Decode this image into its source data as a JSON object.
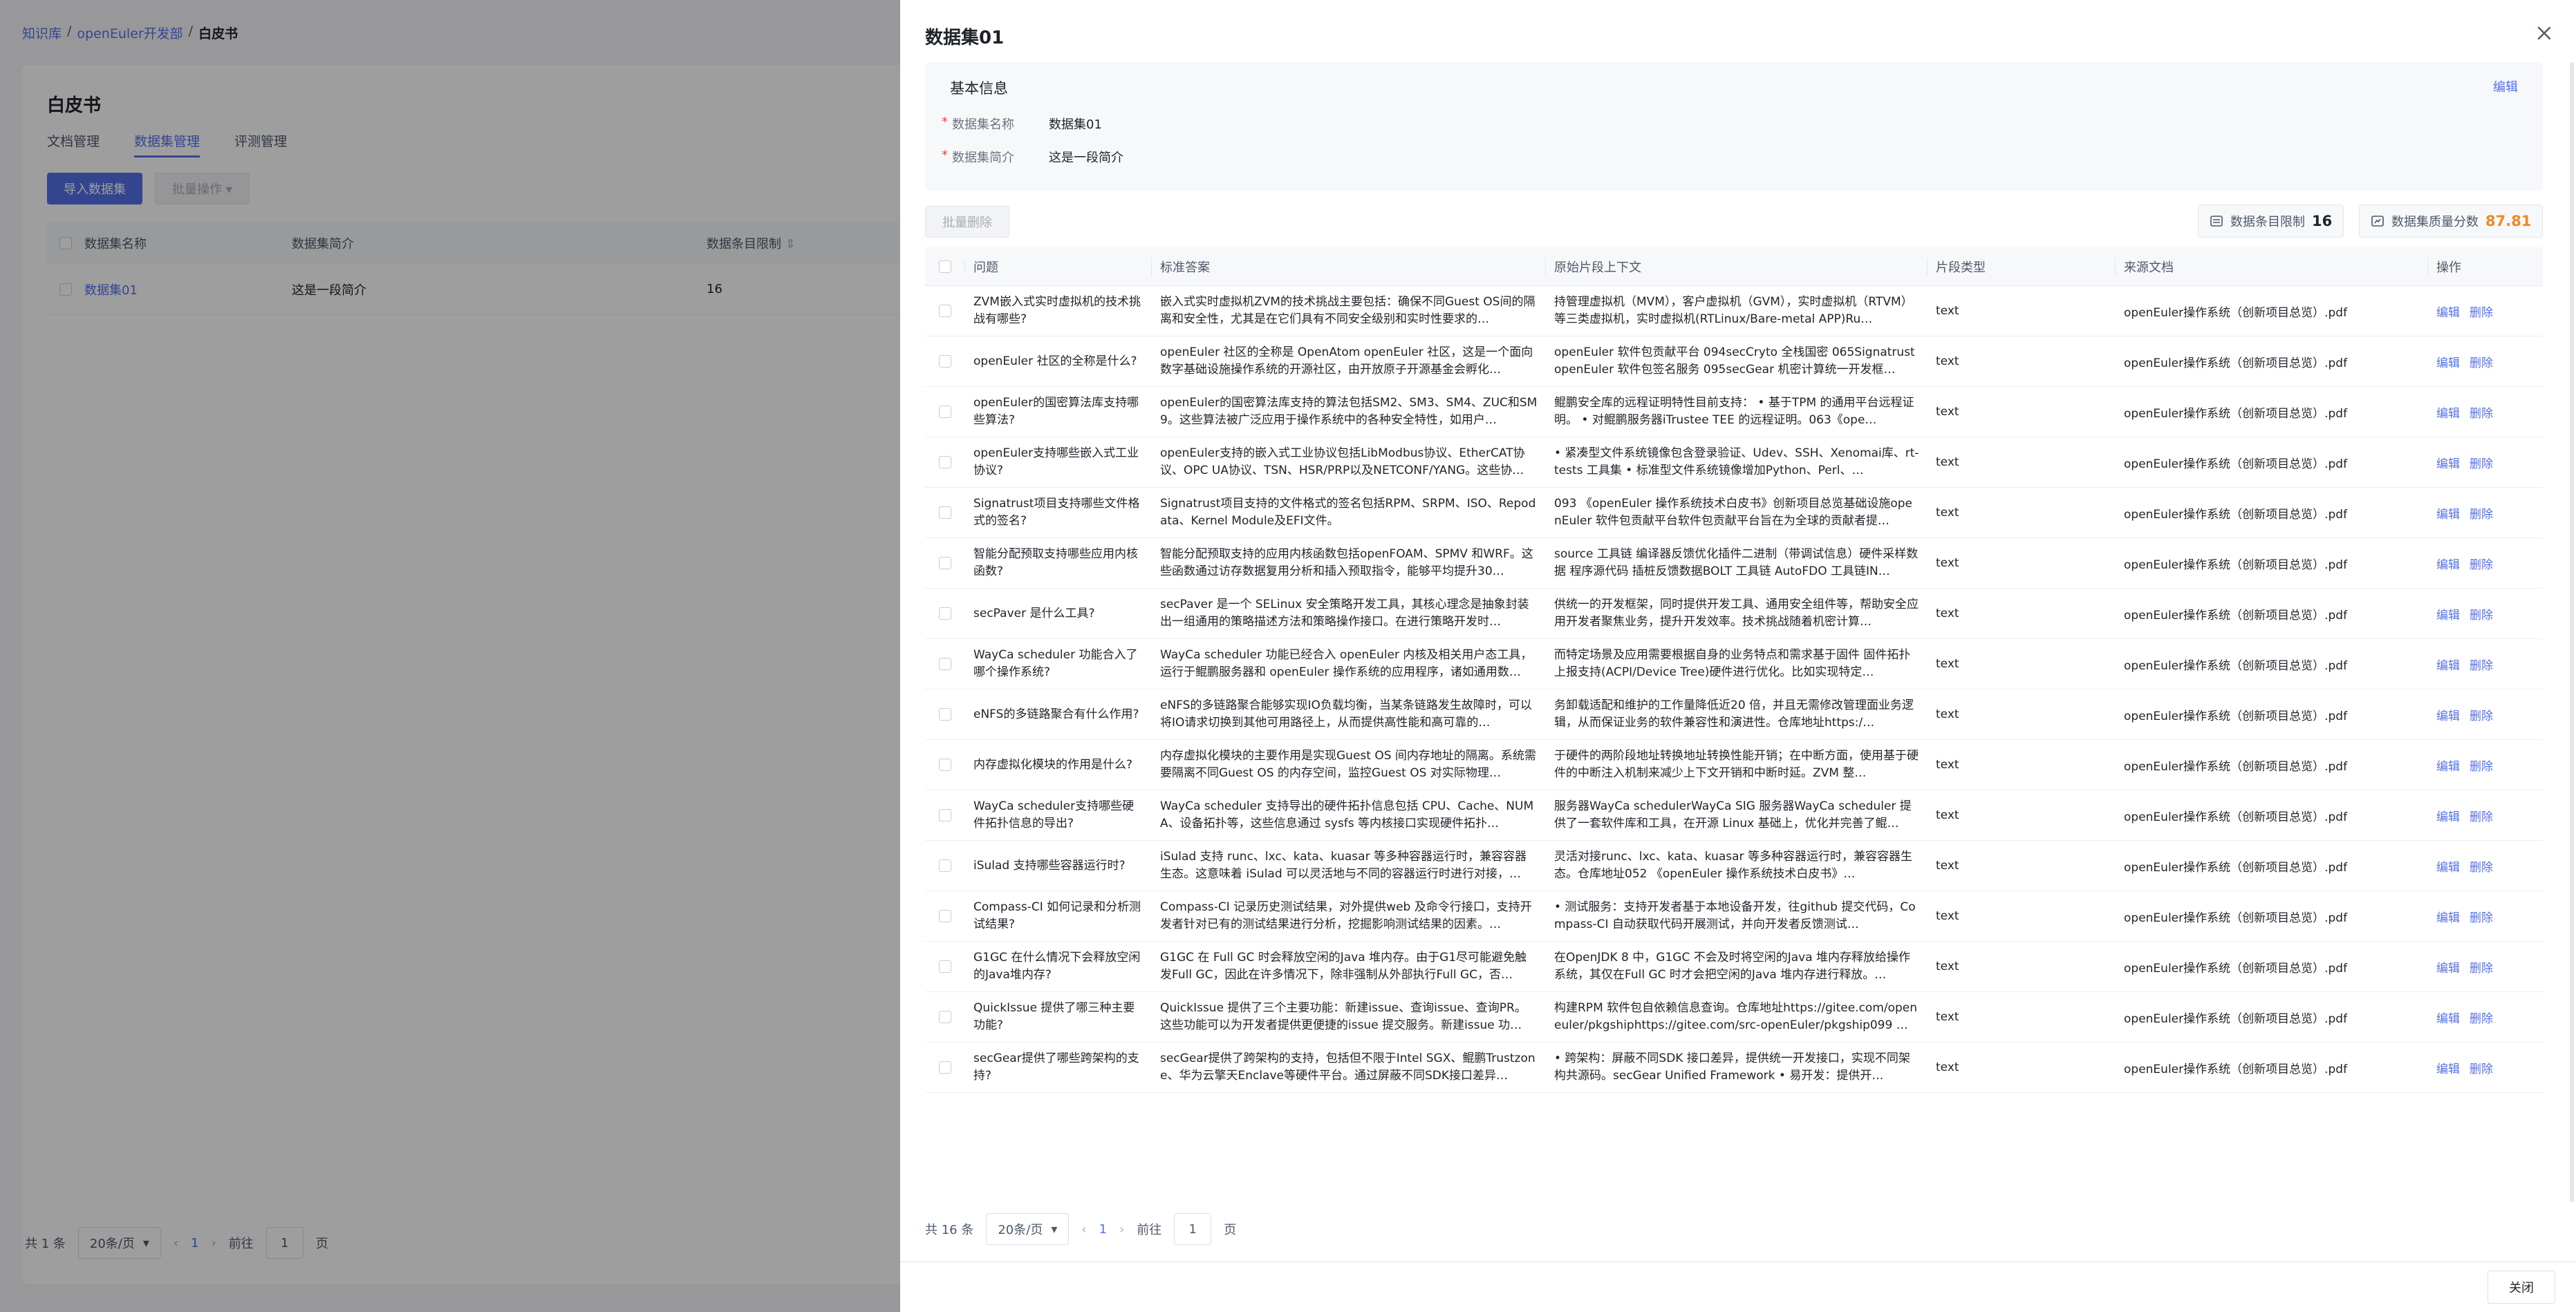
{
  "breadcrumb": [
    "知识库",
    "openEuler开发部",
    "白皮书"
  ],
  "bg": {
    "title": "白皮书",
    "tabs": [
      "文档管理",
      "数据集管理",
      "评测管理"
    ],
    "import_btn": "导入数据集",
    "batch_btn": "批量操作",
    "columns": [
      "数据集名称",
      "数据集简介",
      "数据条目限制"
    ],
    "rows": [
      {
        "name": "数据集01",
        "desc": "这是一段简介",
        "limit": "16"
      }
    ],
    "total": "共 1 条",
    "page_size": "20条/页",
    "page": "1",
    "goto": "前往",
    "goto_val": "1",
    "page_unit": "页"
  },
  "drawer": {
    "title": "数据集01",
    "info": {
      "title": "基本信息",
      "edit": "编辑",
      "name_label": "数据集名称",
      "name_value": "数据集01",
      "desc_label": "数据集简介",
      "desc_value": "这是一段简介"
    },
    "batch_delete": "批量删除",
    "stat_limit_label": "数据条目限制",
    "stat_limit_value": "16",
    "stat_score_label": "数据集质量分数",
    "stat_score_value": "87.81",
    "columns": [
      "问题",
      "标准答案",
      "原始片段上下文",
      "片段类型",
      "来源文档",
      "操作"
    ],
    "edit_label": "编辑",
    "delete_label": "删除",
    "rows": [
      {
        "q": "ZVM嵌入式实时虚拟机的技术挑战有哪些?",
        "a": "嵌入式实时虚拟机ZVM的技术挑战主要包括：确保不同Guest OS间的隔离和安全性，尤其是在它们具有不同安全级别和实时性要求的…",
        "ctx": "持管理虚拟机（MVM），客户虚拟机（GVM），实时虚拟机（RTVM）等三类虚拟机，实时虚拟机(RTLinux/Bare-metal APP)Ru…",
        "type": "text",
        "src": "openEuler操作系统（创新项目总览）.pdf"
      },
      {
        "q": "openEuler 社区的全称是什么?",
        "a": "openEuler 社区的全称是 OpenAtom openEuler 社区，这是一个面向数字基础设施操作系统的开源社区，由开放原子开源基金会孵化…",
        "ctx": "openEuler 软件包贡献平台 094secCryto 全栈国密 065Signatrust openEuler 软件包签名服务 095secGear 机密计算统一开发框…",
        "type": "text",
        "src": "openEuler操作系统（创新项目总览）.pdf"
      },
      {
        "q": "openEuler的国密算法库支持哪些算法?",
        "a": "openEuler的国密算法库支持的算法包括SM2、SM3、SM4、ZUC和SM9。这些算法被广泛应用于操作系统中的各种安全特性，如用户…",
        "ctx": "鲲鹏安全库的远程证明特性目前支持： • 基于TPM 的通用平台远程证明。 • 对鲲鹏服务器iTrustee TEE 的远程证明。063《ope…",
        "type": "text",
        "src": "openEuler操作系统（创新项目总览）.pdf"
      },
      {
        "q": "openEuler支持哪些嵌入式工业协议?",
        "a": "openEuler支持的嵌入式工业协议包括LibModbus协议、EtherCAT协议、OPC UA协议、TSN、HSR/PRP以及NETCONF/YANG。这些协…",
        "ctx": "• 紧凑型文件系统镜像包含登录验证、Udev、SSH、Xenomai库、rt-tests 工具集 • 标准型文件系统镜像增加Python、Perl、…",
        "type": "text",
        "src": "openEuler操作系统（创新项目总览）.pdf"
      },
      {
        "q": "Signatrust项目支持哪些文件格式的签名?",
        "a": "Signatrust项目支持的文件格式的签名包括RPM、SRPM、ISO、Repodata、Kernel Module及EFI文件。",
        "ctx": "093 《openEuler 操作系统技术白皮书》创新项目总览基础设施openEuler 软件包贡献平台软件包贡献平台旨在为全球的贡献者提…",
        "type": "text",
        "src": "openEuler操作系统（创新项目总览）.pdf"
      },
      {
        "q": "智能分配预取支持哪些应用内核函数?",
        "a": "智能分配预取支持的应用内核函数包括openFOAM、SPMV 和WRF。这些函数通过访存数据复用分析和插入预取指令，能够平均提升30…",
        "ctx": "source 工具链 编译器反馈优化插件二进制（带调试信息）硬件采样数据 程序源代码 插桩反馈数据BOLT 工具链 AutoFDO 工具链IN…",
        "type": "text",
        "src": "openEuler操作系统（创新项目总览）.pdf"
      },
      {
        "q": "secPaver 是什么工具?",
        "a": "secPaver 是一个 SELinux 安全策略开发工具，其核心理念是抽象封装出一组通用的策略描述方法和策略操作接口。在进行策略开发时…",
        "ctx": "供统一的开发框架，同时提供开发工具、通用安全组件等，帮助安全应用开发者聚焦业务，提升开发效率。技术挑战随着机密计算…",
        "type": "text",
        "src": "openEuler操作系统（创新项目总览）.pdf"
      },
      {
        "q": "WayCa scheduler 功能合入了哪个操作系统?",
        "a": "WayCa scheduler 功能已经合入 openEuler 内核及相关用户态工具，运行于鲲鹏服务器和 openEuler 操作系统的应用程序，诸如通用数…",
        "ctx": "而特定场景及应用需要根据自身的业务特点和需求基于固件 固件拓扑上报支持(ACPI/Device Tree)硬件进行优化。比如实现特定…",
        "type": "text",
        "src": "openEuler操作系统（创新项目总览）.pdf"
      },
      {
        "q": "eNFS的多链路聚合有什么作用?",
        "a": "eNFS的多链路聚合能够实现IO负载均衡，当某条链路发生故障时，可以将IO请求切换到其他可用路径上，从而提供高性能和高可靠的…",
        "ctx": "务卸载适配和维护的工作量降低近20 倍，并且无需修改管理面业务逻辑，从而保证业务的软件兼容性和演进性。仓库地址https:/…",
        "type": "text",
        "src": "openEuler操作系统（创新项目总览）.pdf"
      },
      {
        "q": "内存虚拟化模块的作用是什么?",
        "a": "内存虚拟化模块的主要作用是实现Guest OS 间内存地址的隔离。系统需要隔离不同Guest OS 的内存空间，监控Guest OS 对实际物理…",
        "ctx": "于硬件的两阶段地址转换地址转换性能开销；在中断方面，使用基于硬件的中断注入机制来减少上下文开销和中断时延。ZVM 整…",
        "type": "text",
        "src": "openEuler操作系统（创新项目总览）.pdf"
      },
      {
        "q": "WayCa scheduler支持哪些硬件拓扑信息的导出?",
        "a": "WayCa scheduler 支持导出的硬件拓扑信息包括 CPU、Cache、NUMA、设备拓扑等，这些信息通过 sysfs 等内核接口实现硬件拓扑…",
        "ctx": "服务器WayCa schedulerWayCa SIG 服务器WayCa scheduler 提供了一套软件库和工具，在开源 Linux 基础上，优化并完善了鲲…",
        "type": "text",
        "src": "openEuler操作系统（创新项目总览）.pdf"
      },
      {
        "q": "iSulad 支持哪些容器运行时?",
        "a": "iSulad 支持 runc、lxc、kata、kuasar 等多种容器运行时，兼容容器生态。这意味着 iSulad 可以灵活地与不同的容器运行时进行对接，…",
        "ctx": "灵活对接runc、lxc、kata、kuasar 等多种容器运行时，兼容容器生态。仓库地址052 《openEuler 操作系统技术白皮书》…",
        "type": "text",
        "src": "openEuler操作系统（创新项目总览）.pdf"
      },
      {
        "q": "Compass-CI 如何记录和分析测试结果?",
        "a": "Compass-CI 记录历史测试结果，对外提供web 及命令行接口，支持开发者针对已有的测试结果进行分析，挖掘影响测试结果的因素。…",
        "ctx": "• 测试服务：支持开发者基于本地设备开发，往github 提交代码，Compass-CI 自动获取代码开展测试，并向开发者反馈测试…",
        "type": "text",
        "src": "openEuler操作系统（创新项目总览）.pdf"
      },
      {
        "q": "G1GC 在什么情况下会释放空闲的Java堆内存?",
        "a": "G1GC 在 Full GC 时会释放空闲的Java 堆内存。由于G1尽可能避免触发Full GC，因此在许多情况下，除非强制从外部执行Full GC，否…",
        "ctx": "在OpenJDK 8 中，G1GC 不会及时将空闲的Java 堆内存释放给操作系统，其仅在Full GC 时才会把空闲的Java 堆内存进行释放。…",
        "type": "text",
        "src": "openEuler操作系统（创新项目总览）.pdf"
      },
      {
        "q": "QuickIssue 提供了哪三种主要功能?",
        "a": "QuickIssue 提供了三个主要功能：新建issue、查询issue、查询PR。这些功能可以为开发者提供更便捷的issue 提交服务。新建issue 功…",
        "ctx": "构建RPM 软件包自依赖信息查询。仓库地址https://gitee.com/openeuler/pkgshiphttps://gitee.com/src-openEuler/pkgship099 …",
        "type": "text",
        "src": "openEuler操作系统（创新项目总览）.pdf"
      },
      {
        "q": "secGear提供了哪些跨架构的支持?",
        "a": "secGear提供了跨架构的支持，包括但不限于Intel SGX、鲲鹏Trustzone、华为云擎天Enclave等硬件平台。通过屏蔽不同SDK接口差异…",
        "ctx": "• 跨架构：屏蔽不同SDK 接口差异，提供统一开发接口，实现不同架构共源码。secGear Unified Framework • 易开发：提供开…",
        "type": "text",
        "src": "openEuler操作系统（创新项目总览）.pdf"
      }
    ],
    "total": "共 16 条",
    "page_size": "20条/页",
    "page": "1",
    "goto": "前往",
    "goto_val": "1",
    "page_unit": "页",
    "close_btn": "关闭"
  }
}
